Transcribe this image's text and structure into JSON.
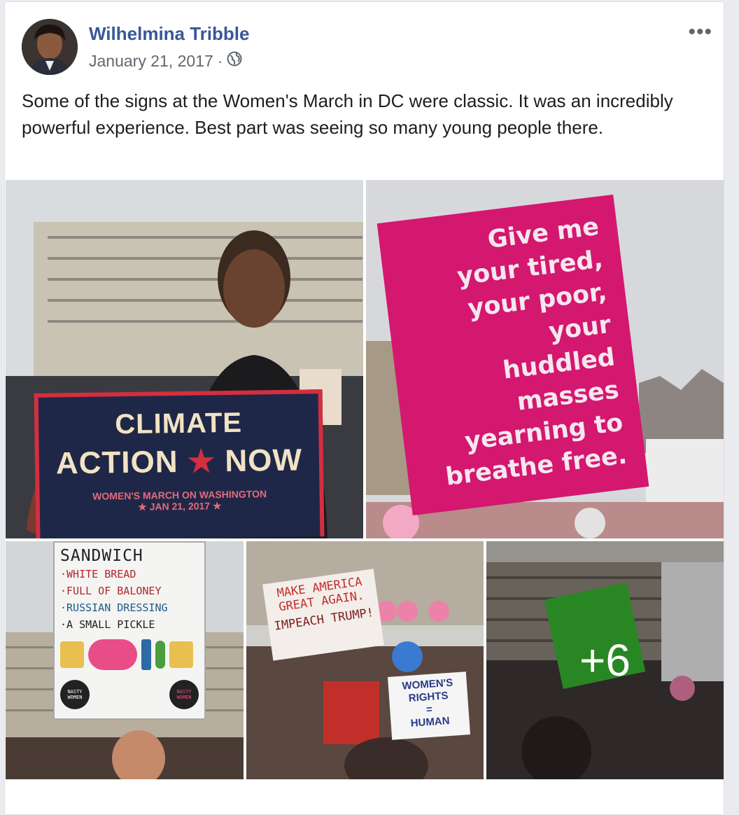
{
  "post": {
    "author": "Wilhelmina Tribble",
    "date": "January 21, 2017",
    "separator": "·",
    "privacy_icon": "globe-icon",
    "menu_icon": "more-options-icon",
    "body": "Some of the signs at the Women's March in DC were classic. It was an incredibly powerful experience. Best part was seeing so many young people there."
  },
  "photos": {
    "p1": {
      "line1": "CLIMATE",
      "line2a": "ACTION",
      "line2b": "NOW",
      "footer1": "WOMEN'S MARCH ON WASHINGTON",
      "footer2": "★ JAN 21, 2017 ★"
    },
    "p2": {
      "lines": [
        "Give me",
        "your tired,",
        "your poor,",
        "your",
        "huddled",
        "masses",
        "yearning to",
        "breathe free."
      ]
    },
    "p3": {
      "lines": [
        "SANDWICH",
        "·WHITE BREAD",
        "·FULL OF BALONEY",
        "·RUSSIAN DRESSING",
        "·A SMALL PICKLE"
      ],
      "badge": "NASTY WOMEN"
    },
    "p4": {
      "sign1": "MAKE AMERICA GREAT AGAIN.",
      "sign2": "IMPEACH TRUMP!",
      "sign3a": "WOMEN'S",
      "sign3b": "RIGHTS",
      "sign3c": "=",
      "sign3d": "HUMAN"
    },
    "p5": {
      "more_count": "+6"
    }
  },
  "colors": {
    "link": "#385898",
    "meta": "#616770",
    "pink_sign": "#d4176f",
    "navy_sign": "#1f2748"
  }
}
